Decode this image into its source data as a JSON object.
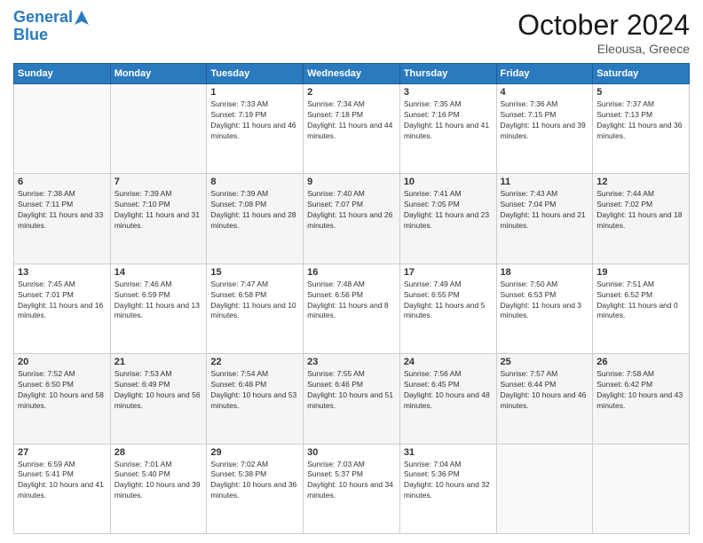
{
  "header": {
    "logo_line1": "General",
    "logo_line2": "Blue",
    "month": "October 2024",
    "location": "Eleousa, Greece"
  },
  "weekdays": [
    "Sunday",
    "Monday",
    "Tuesday",
    "Wednesday",
    "Thursday",
    "Friday",
    "Saturday"
  ],
  "weeks": [
    [
      {
        "day": "",
        "info": ""
      },
      {
        "day": "",
        "info": ""
      },
      {
        "day": "1",
        "info": "Sunrise: 7:33 AM\nSunset: 7:19 PM\nDaylight: 11 hours and 46 minutes."
      },
      {
        "day": "2",
        "info": "Sunrise: 7:34 AM\nSunset: 7:18 PM\nDaylight: 11 hours and 44 minutes."
      },
      {
        "day": "3",
        "info": "Sunrise: 7:35 AM\nSunset: 7:16 PM\nDaylight: 11 hours and 41 minutes."
      },
      {
        "day": "4",
        "info": "Sunrise: 7:36 AM\nSunset: 7:15 PM\nDaylight: 11 hours and 39 minutes."
      },
      {
        "day": "5",
        "info": "Sunrise: 7:37 AM\nSunset: 7:13 PM\nDaylight: 11 hours and 36 minutes."
      }
    ],
    [
      {
        "day": "6",
        "info": "Sunrise: 7:38 AM\nSunset: 7:11 PM\nDaylight: 11 hours and 33 minutes."
      },
      {
        "day": "7",
        "info": "Sunrise: 7:39 AM\nSunset: 7:10 PM\nDaylight: 11 hours and 31 minutes."
      },
      {
        "day": "8",
        "info": "Sunrise: 7:39 AM\nSunset: 7:08 PM\nDaylight: 11 hours and 28 minutes."
      },
      {
        "day": "9",
        "info": "Sunrise: 7:40 AM\nSunset: 7:07 PM\nDaylight: 11 hours and 26 minutes."
      },
      {
        "day": "10",
        "info": "Sunrise: 7:41 AM\nSunset: 7:05 PM\nDaylight: 11 hours and 23 minutes."
      },
      {
        "day": "11",
        "info": "Sunrise: 7:43 AM\nSunset: 7:04 PM\nDaylight: 11 hours and 21 minutes."
      },
      {
        "day": "12",
        "info": "Sunrise: 7:44 AM\nSunset: 7:02 PM\nDaylight: 11 hours and 18 minutes."
      }
    ],
    [
      {
        "day": "13",
        "info": "Sunrise: 7:45 AM\nSunset: 7:01 PM\nDaylight: 11 hours and 16 minutes."
      },
      {
        "day": "14",
        "info": "Sunrise: 7:46 AM\nSunset: 6:59 PM\nDaylight: 11 hours and 13 minutes."
      },
      {
        "day": "15",
        "info": "Sunrise: 7:47 AM\nSunset: 6:58 PM\nDaylight: 11 hours and 10 minutes."
      },
      {
        "day": "16",
        "info": "Sunrise: 7:48 AM\nSunset: 6:56 PM\nDaylight: 11 hours and 8 minutes."
      },
      {
        "day": "17",
        "info": "Sunrise: 7:49 AM\nSunset: 6:55 PM\nDaylight: 11 hours and 5 minutes."
      },
      {
        "day": "18",
        "info": "Sunrise: 7:50 AM\nSunset: 6:53 PM\nDaylight: 11 hours and 3 minutes."
      },
      {
        "day": "19",
        "info": "Sunrise: 7:51 AM\nSunset: 6:52 PM\nDaylight: 11 hours and 0 minutes."
      }
    ],
    [
      {
        "day": "20",
        "info": "Sunrise: 7:52 AM\nSunset: 6:50 PM\nDaylight: 10 hours and 58 minutes."
      },
      {
        "day": "21",
        "info": "Sunrise: 7:53 AM\nSunset: 6:49 PM\nDaylight: 10 hours and 56 minutes."
      },
      {
        "day": "22",
        "info": "Sunrise: 7:54 AM\nSunset: 6:48 PM\nDaylight: 10 hours and 53 minutes."
      },
      {
        "day": "23",
        "info": "Sunrise: 7:55 AM\nSunset: 6:46 PM\nDaylight: 10 hours and 51 minutes."
      },
      {
        "day": "24",
        "info": "Sunrise: 7:56 AM\nSunset: 6:45 PM\nDaylight: 10 hours and 48 minutes."
      },
      {
        "day": "25",
        "info": "Sunrise: 7:57 AM\nSunset: 6:44 PM\nDaylight: 10 hours and 46 minutes."
      },
      {
        "day": "26",
        "info": "Sunrise: 7:58 AM\nSunset: 6:42 PM\nDaylight: 10 hours and 43 minutes."
      }
    ],
    [
      {
        "day": "27",
        "info": "Sunrise: 6:59 AM\nSunset: 5:41 PM\nDaylight: 10 hours and 41 minutes."
      },
      {
        "day": "28",
        "info": "Sunrise: 7:01 AM\nSunset: 5:40 PM\nDaylight: 10 hours and 39 minutes."
      },
      {
        "day": "29",
        "info": "Sunrise: 7:02 AM\nSunset: 5:38 PM\nDaylight: 10 hours and 36 minutes."
      },
      {
        "day": "30",
        "info": "Sunrise: 7:03 AM\nSunset: 5:37 PM\nDaylight: 10 hours and 34 minutes."
      },
      {
        "day": "31",
        "info": "Sunrise: 7:04 AM\nSunset: 5:36 PM\nDaylight: 10 hours and 32 minutes."
      },
      {
        "day": "",
        "info": ""
      },
      {
        "day": "",
        "info": ""
      }
    ]
  ]
}
